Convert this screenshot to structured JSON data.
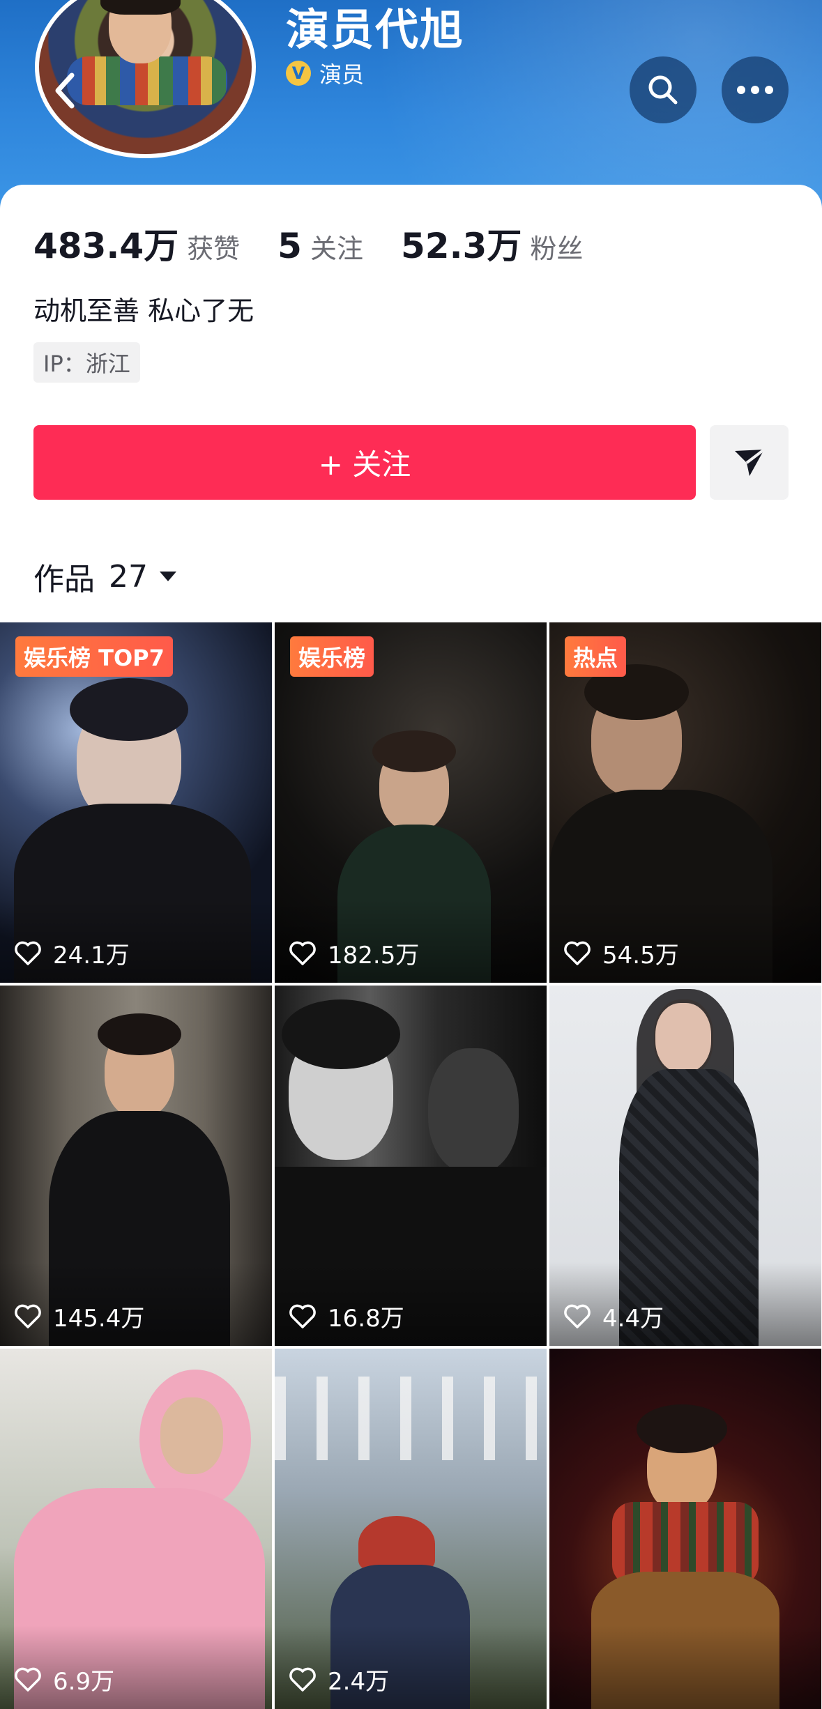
{
  "profile": {
    "name": "演员代旭",
    "verified_label": "演员",
    "verified_badge": "V",
    "stats": [
      {
        "value": "483.4万",
        "label": "获赞"
      },
      {
        "value": "5",
        "label": "关注"
      },
      {
        "value": "52.3万",
        "label": "粉丝"
      }
    ],
    "bio": "动机至善 私心了无",
    "ip": "IP：浙江"
  },
  "actions": {
    "follow_label": "+ 关注"
  },
  "works": {
    "label": "作品",
    "count": "27"
  },
  "videos": [
    {
      "badge": "娱乐榜 TOP7",
      "likes": "24.1万"
    },
    {
      "badge": "娱乐榜",
      "likes": "182.5万"
    },
    {
      "badge": "热点",
      "likes": "54.5万"
    },
    {
      "badge": "",
      "likes": "145.4万"
    },
    {
      "badge": "",
      "likes": "16.8万"
    },
    {
      "badge": "",
      "likes": "4.4万"
    },
    {
      "badge": "",
      "likes": "6.9万"
    },
    {
      "badge": "",
      "likes": "2.4万"
    },
    {
      "badge": "",
      "likes": ""
    }
  ],
  "colors": {
    "follow_button": "#fe2c55",
    "header": "#2f86dc",
    "badge": "#ff6a40"
  }
}
